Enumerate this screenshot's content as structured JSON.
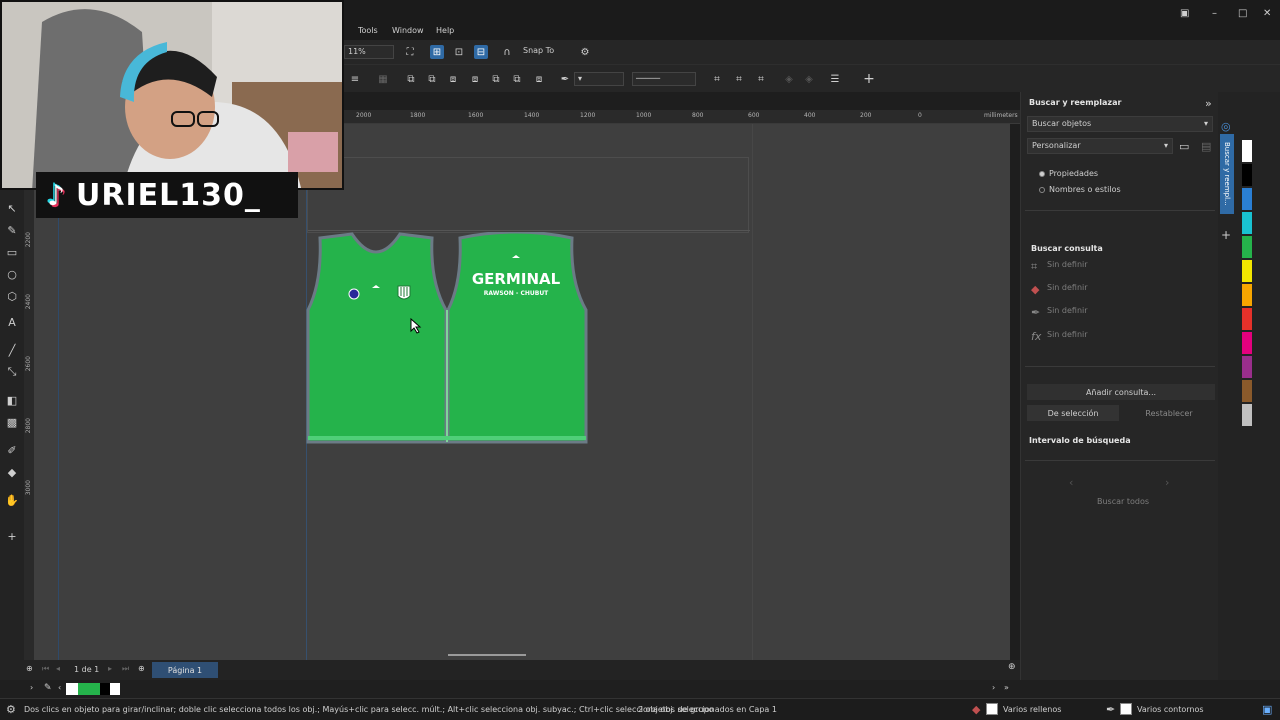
{
  "menu": {
    "tools": "Tools",
    "window": "Window",
    "help": "Help"
  },
  "toolbar": {
    "zoom_value": "11%",
    "snap_to": "Snap To"
  },
  "ruler": {
    "ticks": [
      "2000",
      "1800",
      "1600",
      "1400",
      "1200",
      "1000",
      "800",
      "600",
      "400",
      "200",
      "0"
    ],
    "unit": "millimeters",
    "vticks": [
      "2200",
      "2400",
      "2600",
      "2800",
      "3000"
    ]
  },
  "shirts": {
    "brand": "GERMINAL",
    "subtitle": "RAWSON - CHUBUT",
    "fill_color": "#25b34b",
    "trim_color": "#6b7b86"
  },
  "docker": {
    "title": "Buscar y reemplazar",
    "mode_select": "Buscar objetos",
    "preset_select": "Personalizar",
    "radio_properties": "Propiedades",
    "radio_names": "Nombres o estilos",
    "query_title": "Buscar consulta",
    "query_items": [
      "Sin definir",
      "Sin definir",
      "Sin definir",
      "Sin definir"
    ],
    "add_query": "Añadir consulta...",
    "from_selection": "De selección",
    "reset": "Restablecer",
    "interval_title": "Intervalo de búsqueda",
    "find_all": "Buscar todos",
    "side_tab": "Buscar y reempl..."
  },
  "pagebar": {
    "page_count": "1 de 1",
    "page_tab": "Página 1"
  },
  "status": {
    "hint": "Dos clics en objeto para girar/inclinar; doble clic selecciona todos los obj.; Mayús+clic para selecc. múlt.; Alt+clic selecciona obj. subyac.; Ctrl+clic selecciona obj. de grupo",
    "selection": "2 objetos seleccionados en Capa 1",
    "fill": "Varios rellenos",
    "outline": "Varios contornos"
  },
  "overlay": {
    "streamer_tag": "URIEL130_"
  },
  "colors": {
    "accent": "#2f6aa5",
    "canvas": "#3f3f3f",
    "panel": "#262626"
  },
  "palette": [
    "#ffffff",
    "#000000",
    "#2a7fd4",
    "#19c2d1",
    "#25b34b",
    "#f2e600",
    "#f7a600",
    "#e5312a",
    "#e4007e",
    "#9a2e8c",
    "#8a5a2b",
    "#c0c0c0"
  ]
}
